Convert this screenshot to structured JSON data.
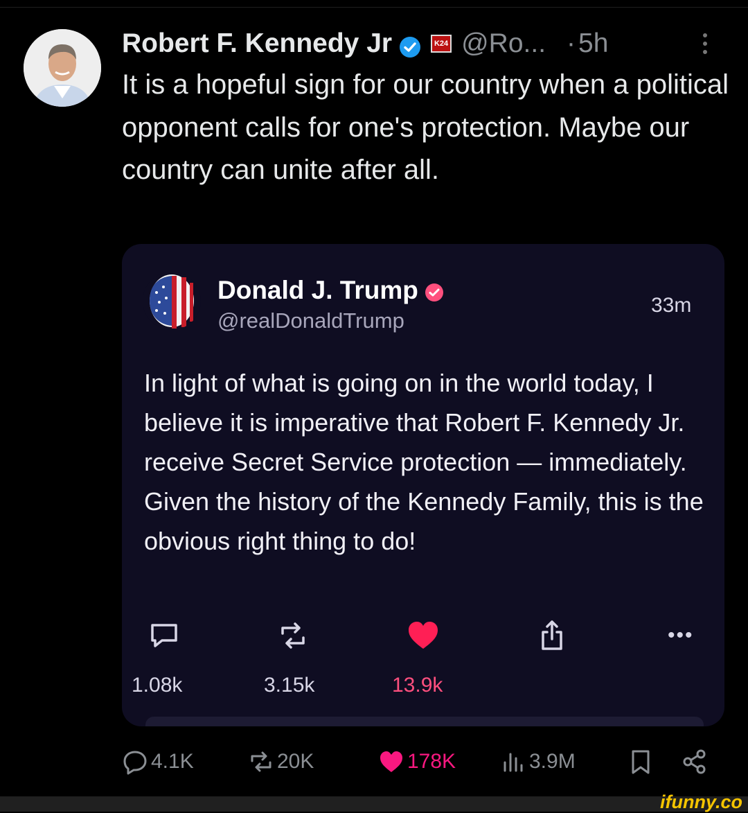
{
  "tweet": {
    "author_name": "Robert F. Kennedy Jr",
    "flag_label": "K24",
    "handle": "@Ro...",
    "separator": "·",
    "time": "5h",
    "text": "It is a hopeful sign for our country when a political opponent calls for one's protection. Maybe our country can unite after all."
  },
  "quoted": {
    "author_name": "Donald J. Trump",
    "handle": "@realDonaldTrump",
    "time": "33m",
    "text": "In light of what is going on in the world today, I believe it is imperative that Robert F. Kennedy Jr. receive Secret Service protection — immediately. Given the history of the Kennedy Family, this is the obvious right thing to do!",
    "counts": {
      "replies": "1.08k",
      "reposts": "3.15k",
      "likes": "13.9k"
    },
    "more_label": "•••"
  },
  "actions": {
    "replies": "4.1K",
    "reposts": "20K",
    "likes": "178K",
    "views": "3.9M"
  },
  "watermark": "ifunny.co",
  "colors": {
    "background": "#000000",
    "card": "#0f0d22",
    "verified": "#1d9bf0",
    "like": "#f91880",
    "muted": "#8b8f94"
  },
  "icons": [
    "verified-icon",
    "reply-icon",
    "repost-icon",
    "heart-icon",
    "share-icon",
    "views-icon",
    "bookmark-icon",
    "share-network-icon"
  ]
}
